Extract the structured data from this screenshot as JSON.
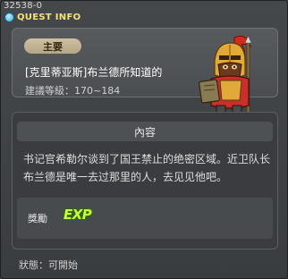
{
  "window": {
    "quest_id": "32538-0",
    "title": "QUEST INFO",
    "icon": "info-icon"
  },
  "header": {
    "tag_label": "主要",
    "quest_name": "[克里蒂亚斯]布兰德所知道的",
    "level_range": "建議等級：170~184",
    "npc_portrait": "armored-knight-npc-icon"
  },
  "content": {
    "heading": "內容",
    "description": "书记官希勒尔谈到了国王禁止的绝密区域。近卫队长布兰德是唯一去过那里的人，去见见他吧。",
    "reward_label": "獎勵",
    "reward_icon_text": "EXP"
  },
  "footer": {
    "status": "狀態：可開始"
  },
  "colors": {
    "title": "#f5e27a",
    "tag_bg": "#c4b393",
    "exp_green": "#c8ff3a"
  }
}
